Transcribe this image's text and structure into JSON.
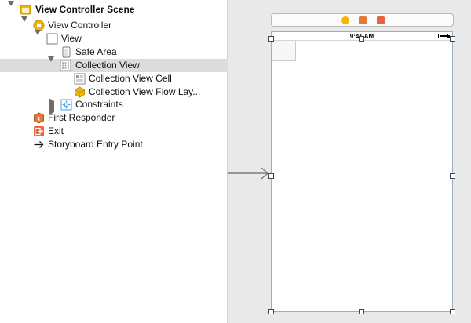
{
  "outline": {
    "items": [
      {
        "label": "View Controller Scene",
        "icon": "scene-icon"
      },
      {
        "label": "View Controller",
        "icon": "view-controller-icon"
      },
      {
        "label": "View",
        "icon": "view-icon"
      },
      {
        "label": "Safe Area",
        "icon": "safe-area-icon"
      },
      {
        "label": "Collection View",
        "icon": "collection-view-icon"
      },
      {
        "label": "Collection View Cell",
        "icon": "collection-view-cell-icon"
      },
      {
        "label": "Collection View Flow Lay...",
        "icon": "flow-layout-icon"
      },
      {
        "label": "Constraints",
        "icon": "constraints-icon"
      },
      {
        "label": "First Responder",
        "icon": "first-responder-icon"
      },
      {
        "label": "Exit",
        "icon": "exit-icon"
      },
      {
        "label": "Storyboard Entry Point",
        "icon": "arrow-right-icon"
      }
    ]
  },
  "canvas": {
    "status_time": "9:41 AM",
    "dock_icons": [
      "view-controller-icon",
      "first-responder-icon",
      "exit-icon"
    ]
  },
  "colors": {
    "selection": "#dcdcdc",
    "canvas_bg": "#e9e9e9",
    "scene_yellow": "#f2b705",
    "first_responder_orange": "#e2793a",
    "exit_orange": "#e8643a",
    "constraints_blue": "#4aa0de"
  }
}
